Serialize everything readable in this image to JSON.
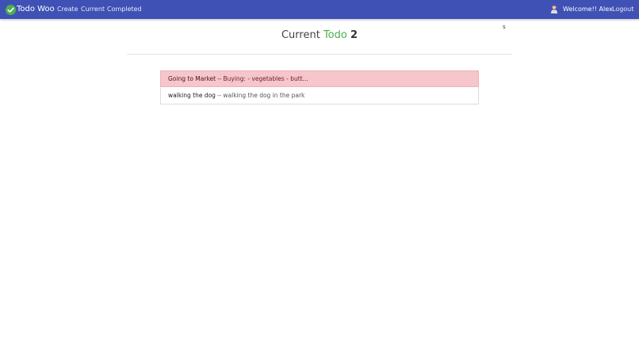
{
  "navbar": {
    "brand": "Todo Woo",
    "links": [
      "Create",
      "Current",
      "Completed"
    ],
    "welcome": "Welcome!! Alex",
    "logout": "Logout",
    "brand_icon": "check-circle-icon",
    "avatar_icon": "user-avatar-icon",
    "color": "#3f51b5"
  },
  "stray_text": "s",
  "heading": {
    "prefix": "Current",
    "highlight": "Todo",
    "count": "2",
    "highlight_color": "#4caf50"
  },
  "todos": [
    {
      "title": "Going to Market",
      "separator": "--",
      "memo": "Buying: - vegetables - butt...",
      "important": true
    },
    {
      "title": "walking the dog",
      "separator": "--",
      "memo": "walking the dog in the park",
      "important": false
    }
  ]
}
